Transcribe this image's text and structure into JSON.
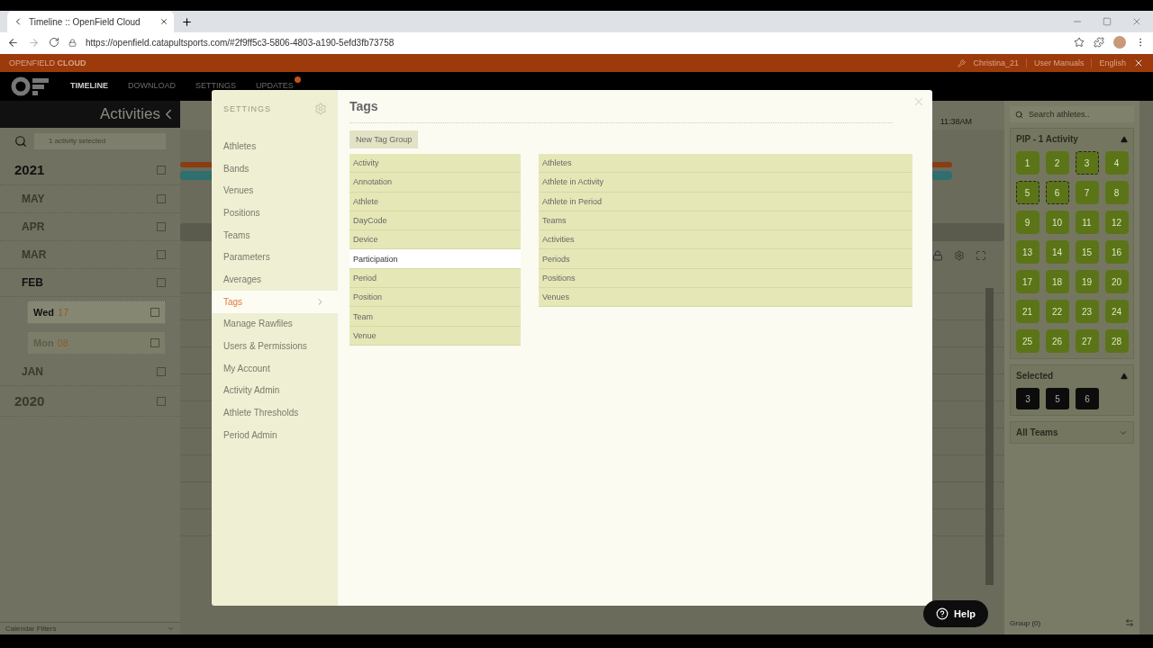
{
  "browser": {
    "tab_title": "Timeline :: OpenField Cloud",
    "url": "https://openfield.catapultsports.com/#2f9ff5c3-5806-4803-a190-5efd3fb73758"
  },
  "app_bar": {
    "brand": "OPENFIELD **CLOUD**",
    "user": "Christina_21",
    "manuals": "User Manuals",
    "language": "English"
  },
  "nav": [
    {
      "label": "TIMELINE",
      "selected": true,
      "badge": false
    },
    {
      "label": "DOWNLOAD",
      "selected": false,
      "badge": false
    },
    {
      "label": "SETTINGS",
      "selected": false,
      "badge": false
    },
    {
      "label": "UPDATES",
      "selected": false,
      "badge": true
    }
  ],
  "calendar": {
    "title": "Activities",
    "search_value": "1 activity selected",
    "footer": "Calendar Filters",
    "tree": [
      {
        "label": "2021",
        "disabled": false,
        "checked": false,
        "children": [
          {
            "label": "MAY",
            "disabled": true,
            "checked": false
          },
          {
            "label": "APR",
            "disabled": true,
            "checked": false
          },
          {
            "label": "MAR",
            "disabled": true,
            "checked": false
          },
          {
            "label": "FEB",
            "disabled": false,
            "checked": false,
            "children": [
              {
                "label": "Wed",
                "date": "17",
                "disabled": false,
                "checked": false
              },
              {
                "label": "Mon",
                "date": "08",
                "disabled": true,
                "checked": false
              }
            ]
          },
          {
            "label": "JAN",
            "disabled": true,
            "checked": false
          }
        ]
      },
      {
        "label": "2020",
        "disabled": true,
        "checked": false
      }
    ]
  },
  "timeline": {
    "time": "11:38AM"
  },
  "settings_modal": {
    "heading": "SETTINGS",
    "menu": [
      {
        "label": "Athletes",
        "selected": false
      },
      {
        "label": "Bands",
        "selected": false
      },
      {
        "label": "Venues",
        "selected": false
      },
      {
        "label": "Positions",
        "selected": false
      },
      {
        "label": "Teams",
        "selected": false
      },
      {
        "label": "Parameters",
        "selected": false
      },
      {
        "label": "Averages",
        "selected": false
      },
      {
        "label": "Tags",
        "selected": true
      },
      {
        "label": "Manage Rawfiles",
        "selected": false
      },
      {
        "label": "Users & Permissions",
        "selected": false
      },
      {
        "label": "My Account",
        "selected": false
      },
      {
        "label": "Activity Admin",
        "selected": false
      },
      {
        "label": "Athlete Thresholds",
        "selected": false
      },
      {
        "label": "Period Admin",
        "selected": false
      }
    ],
    "title": "Tags",
    "new_button": "New Tag Group",
    "tag_groups": [
      {
        "label": "Activity",
        "hovered": false
      },
      {
        "label": "Annotation",
        "hovered": false
      },
      {
        "label": "Athlete",
        "hovered": false
      },
      {
        "label": "DayCode",
        "hovered": false
      },
      {
        "label": "Device",
        "hovered": false
      },
      {
        "label": "Participation",
        "hovered": true
      },
      {
        "label": "Period",
        "hovered": false
      },
      {
        "label": "Position",
        "hovered": false
      },
      {
        "label": "Team",
        "hovered": false
      },
      {
        "label": "Venue",
        "hovered": false
      }
    ],
    "tag_targets": [
      "Athletes",
      "Athlete in Activity",
      "Athlete in Period",
      "Teams",
      "Activities",
      "Periods",
      "Positions",
      "Venues"
    ]
  },
  "athletes_panel": {
    "search_placeholder": "Search athletes..",
    "group_title": "PIP - 1 Activity",
    "group_expanded": true,
    "athletes": [
      {
        "number": "1",
        "selected": false
      },
      {
        "number": "2",
        "selected": false
      },
      {
        "number": "3",
        "selected": true
      },
      {
        "number": "4",
        "selected": false
      },
      {
        "number": "5",
        "selected": true
      },
      {
        "number": "6",
        "selected": true
      },
      {
        "number": "7",
        "selected": false
      },
      {
        "number": "8",
        "selected": false
      },
      {
        "number": "9",
        "selected": false
      },
      {
        "number": "10",
        "selected": false
      },
      {
        "number": "11",
        "selected": false
      },
      {
        "number": "12",
        "selected": false
      },
      {
        "number": "13",
        "selected": false
      },
      {
        "number": "14",
        "selected": false
      },
      {
        "number": "15",
        "selected": false
      },
      {
        "number": "16",
        "selected": false
      },
      {
        "number": "17",
        "selected": false
      },
      {
        "number": "18",
        "selected": false
      },
      {
        "number": "19",
        "selected": false
      },
      {
        "number": "20",
        "selected": false
      },
      {
        "number": "21",
        "selected": false
      },
      {
        "number": "22",
        "selected": false
      },
      {
        "number": "23",
        "selected": false
      },
      {
        "number": "24",
        "selected": false
      },
      {
        "number": "25",
        "selected": false
      },
      {
        "number": "26",
        "selected": false
      },
      {
        "number": "27",
        "selected": false
      },
      {
        "number": "28",
        "selected": false
      }
    ],
    "selected_title": "Selected",
    "selected_expanded": true,
    "selected_chips": [
      "3",
      "5",
      "6"
    ],
    "teams_dropdown": "All Teams",
    "group_footer": "Group (0)"
  },
  "help_button": "Help"
}
